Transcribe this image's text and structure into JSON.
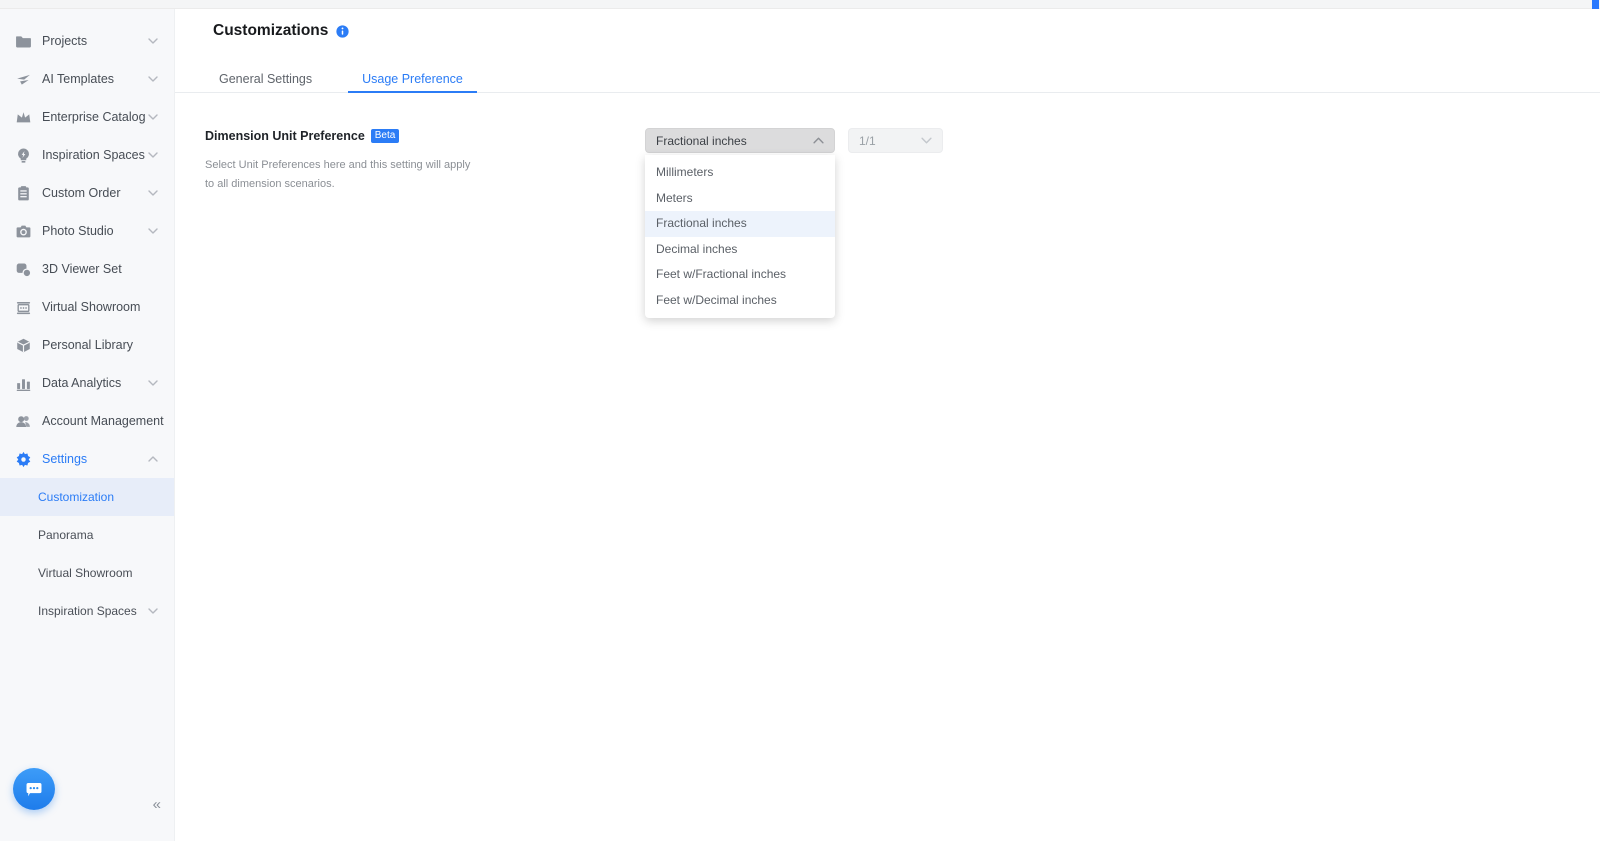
{
  "accent_color": "#2b7cf6",
  "top_bar": {
    "scroll_thumb_color": "#2979ff"
  },
  "sidebar": {
    "items": [
      {
        "label": "Projects",
        "icon": "folder-icon",
        "chevron": "down"
      },
      {
        "label": "AI Templates",
        "icon": "ai-templates-icon",
        "chevron": "down"
      },
      {
        "label": "Enterprise Catalog",
        "icon": "crown-icon",
        "chevron": "down"
      },
      {
        "label": "Inspiration Spaces",
        "icon": "lightbulb-icon",
        "chevron": "down"
      },
      {
        "label": "Custom Order",
        "icon": "clipboard-icon",
        "chevron": "down"
      },
      {
        "label": "Photo Studio",
        "icon": "camera-icon",
        "chevron": "down"
      },
      {
        "label": "3D Viewer Set",
        "icon": "cube-icon",
        "chevron": null
      },
      {
        "label": "Virtual Showroom",
        "icon": "storefront-icon",
        "chevron": null
      },
      {
        "label": "Personal Library",
        "icon": "box-icon",
        "chevron": null
      },
      {
        "label": "Data Analytics",
        "icon": "bar-chart-icon",
        "chevron": "down"
      },
      {
        "label": "Account Management",
        "icon": "users-icon",
        "chevron": null
      },
      {
        "label": "Settings",
        "icon": "gear-icon",
        "chevron": "up",
        "active": true
      }
    ],
    "settings_subitems": [
      {
        "label": "Customization",
        "selected": true
      },
      {
        "label": "Panorama",
        "selected": false
      },
      {
        "label": "Virtual Showroom",
        "selected": false
      },
      {
        "label": "Inspiration Spaces",
        "selected": false,
        "chevron": "down"
      }
    ],
    "collapse_glyph": "«"
  },
  "header": {
    "title": "Customizations",
    "info_icon": "info-icon"
  },
  "tabs": [
    {
      "label": "General Settings",
      "active": false
    },
    {
      "label": "Usage Preference",
      "active": true
    }
  ],
  "preference": {
    "label": "Dimension Unit Preference",
    "badge": "Beta",
    "description": "Select Unit Preferences here and this setting will apply to all dimension scenarios.",
    "unit_select": {
      "value": "Fractional inches",
      "state": "open"
    },
    "precision_select": {
      "value": "1/1",
      "state": "disabled"
    },
    "unit_options": [
      {
        "label": "Millimeters",
        "selected": false
      },
      {
        "label": "Meters",
        "selected": false
      },
      {
        "label": "Fractional inches",
        "selected": true
      },
      {
        "label": "Decimal inches",
        "selected": false
      },
      {
        "label": "Feet w/Fractional inches",
        "selected": false
      },
      {
        "label": "Feet w/Decimal inches",
        "selected": false
      }
    ]
  },
  "chat_button": {
    "icon": "chat-bubble-icon"
  }
}
